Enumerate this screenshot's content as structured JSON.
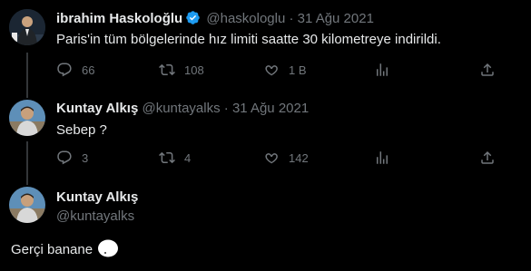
{
  "thread": [
    {
      "name": "ibrahim Haskoloğlu",
      "verified": true,
      "handle": "@haskologlu",
      "separator": "·",
      "date": "31 Ağu 2021",
      "text": "Paris'in tüm bölgelerinde hız limiti saatte 30 kilometreye indirildi.",
      "replies": "66",
      "retweets": "108",
      "likes": "1 B",
      "views": ""
    },
    {
      "name": "Kuntay Alkış",
      "verified": false,
      "handle": "@kuntayalks",
      "separator": "·",
      "date": "31 Ağu 2021",
      "text": "Sebep ?",
      "replies": "3",
      "retweets": "4",
      "likes": "142",
      "views": ""
    }
  ],
  "main_tweet": {
    "name": "Kuntay Alkış",
    "handle": "@kuntayalks",
    "text": "Gerçi banane"
  },
  "colors": {
    "background": "#000000",
    "text": "#e7e9ea",
    "muted": "#71767b",
    "verified_badge": "#1d9bf0",
    "thread_line": "#333639"
  },
  "icons": [
    "reply-icon",
    "retweet-icon",
    "like-icon",
    "views-icon",
    "share-icon",
    "verified-badge-icon"
  ]
}
